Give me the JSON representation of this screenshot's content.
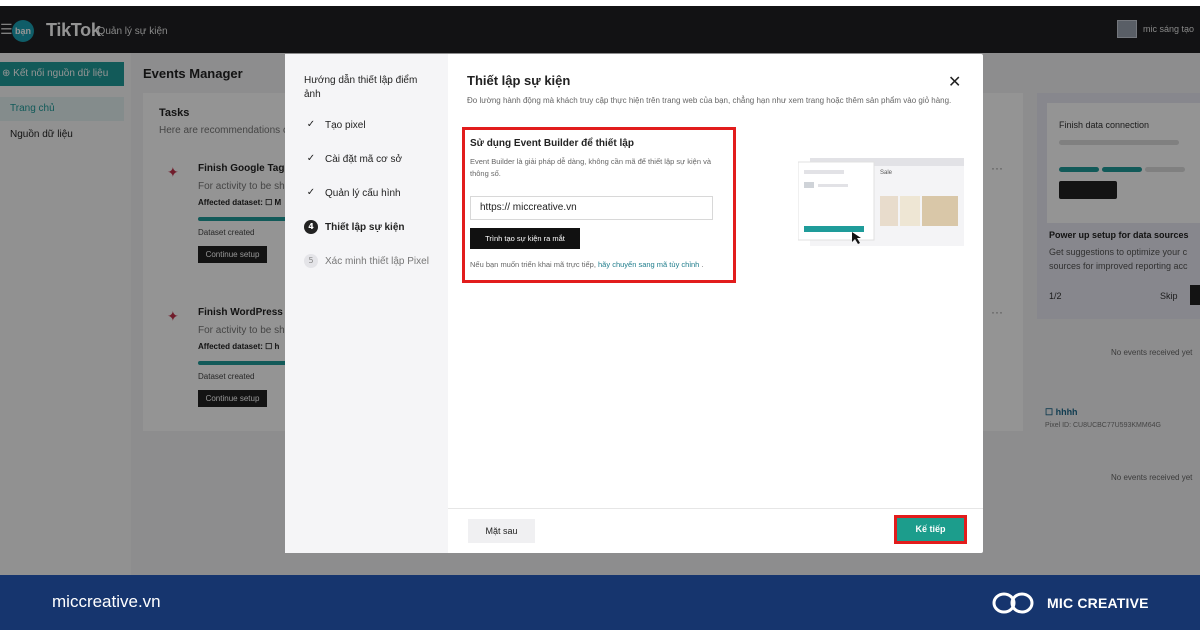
{
  "topbar": {
    "menu_icon": "menu-icon",
    "logo_badge": "bạn",
    "title": "TikTok",
    "subtitle": ": Quản lý sự kiện",
    "user_name": "mic sáng tạo"
  },
  "left_nav": {
    "connect_label": "⊕ Kết nối nguồn dữ liệu",
    "home_label": "Trang chủ",
    "data_sources_label": "Nguồn dữ liệu"
  },
  "background": {
    "page_title": "Events Manager",
    "tasks_title": "Tasks",
    "tasks_sub": "Here are recommendations c",
    "tasks": [
      {
        "name": "Finish Google Tag M",
        "desc": "For activity to be sh",
        "affected": "Affected dataset: ☐ M",
        "created": "Dataset created",
        "button": "Continue setup"
      },
      {
        "name": "Finish WordPress se",
        "desc": "For activity to be sh",
        "affected": "Affected dataset: ☐ h",
        "created": "Dataset created",
        "button": "Continue setup"
      }
    ],
    "right_panel": {
      "card_title": "Finish data connection",
      "title": "Power up setup for data sources",
      "desc_line1": "Get suggestions to optimize your c",
      "desc_line2": "sources for improved reporting acc",
      "page": "1/2",
      "skip": "Skip"
    },
    "no_events_1": "No events received yet",
    "pixel_name": "☐ hhhh",
    "pixel_id": "Pixel ID: CU8UCBC77U593KMM64G",
    "no_events_2": "No events received yet"
  },
  "modal": {
    "steps_title": "Hướng dẫn thiết lập điểm ảnh",
    "steps": [
      {
        "label": "Tạo pixel",
        "state": "done",
        "marker": "✓"
      },
      {
        "label": "Cài đặt mã cơ sở",
        "state": "done",
        "marker": "✓"
      },
      {
        "label": "Quản lý cấu hình",
        "state": "done",
        "marker": "✓"
      },
      {
        "label": "Thiết lập sự kiện",
        "state": "current",
        "marker": "4"
      },
      {
        "label": "Xác minh thiết lập Pixel",
        "state": "pending",
        "marker": "5"
      }
    ],
    "title": "Thiết lập sự kiện",
    "description": "Đo lường hành động mà khách truy cập thực hiện trên trang web của bạn, chẳng hạn như xem trang hoặc thêm sản phẩm vào giỏ hàng.",
    "builder": {
      "title": "Sử dụng Event Builder để thiết lập",
      "description": "Event Builder là giải pháp dễ dàng, không cần mã để thiết lập sự kiện và thông số.",
      "url_value": "https://  miccreative.vn",
      "launch_button": "Trình tạo sự kiện ra mắt",
      "note_prefix": "Nếu bạn muốn triển khai mã trực tiếp,",
      "note_link": "hãy chuyển sang mã tùy chỉnh",
      "note_suffix": "."
    },
    "illustration_label": "Sale",
    "back_button": "Mặt sau",
    "next_button": "Kế tiếp",
    "highlight_color": "#e21c1c",
    "accent_color": "#1c9d8c"
  },
  "banner": {
    "url": "miccreative.vn",
    "brand": "MIC CREATIVE",
    "background_color": "#16356e"
  }
}
